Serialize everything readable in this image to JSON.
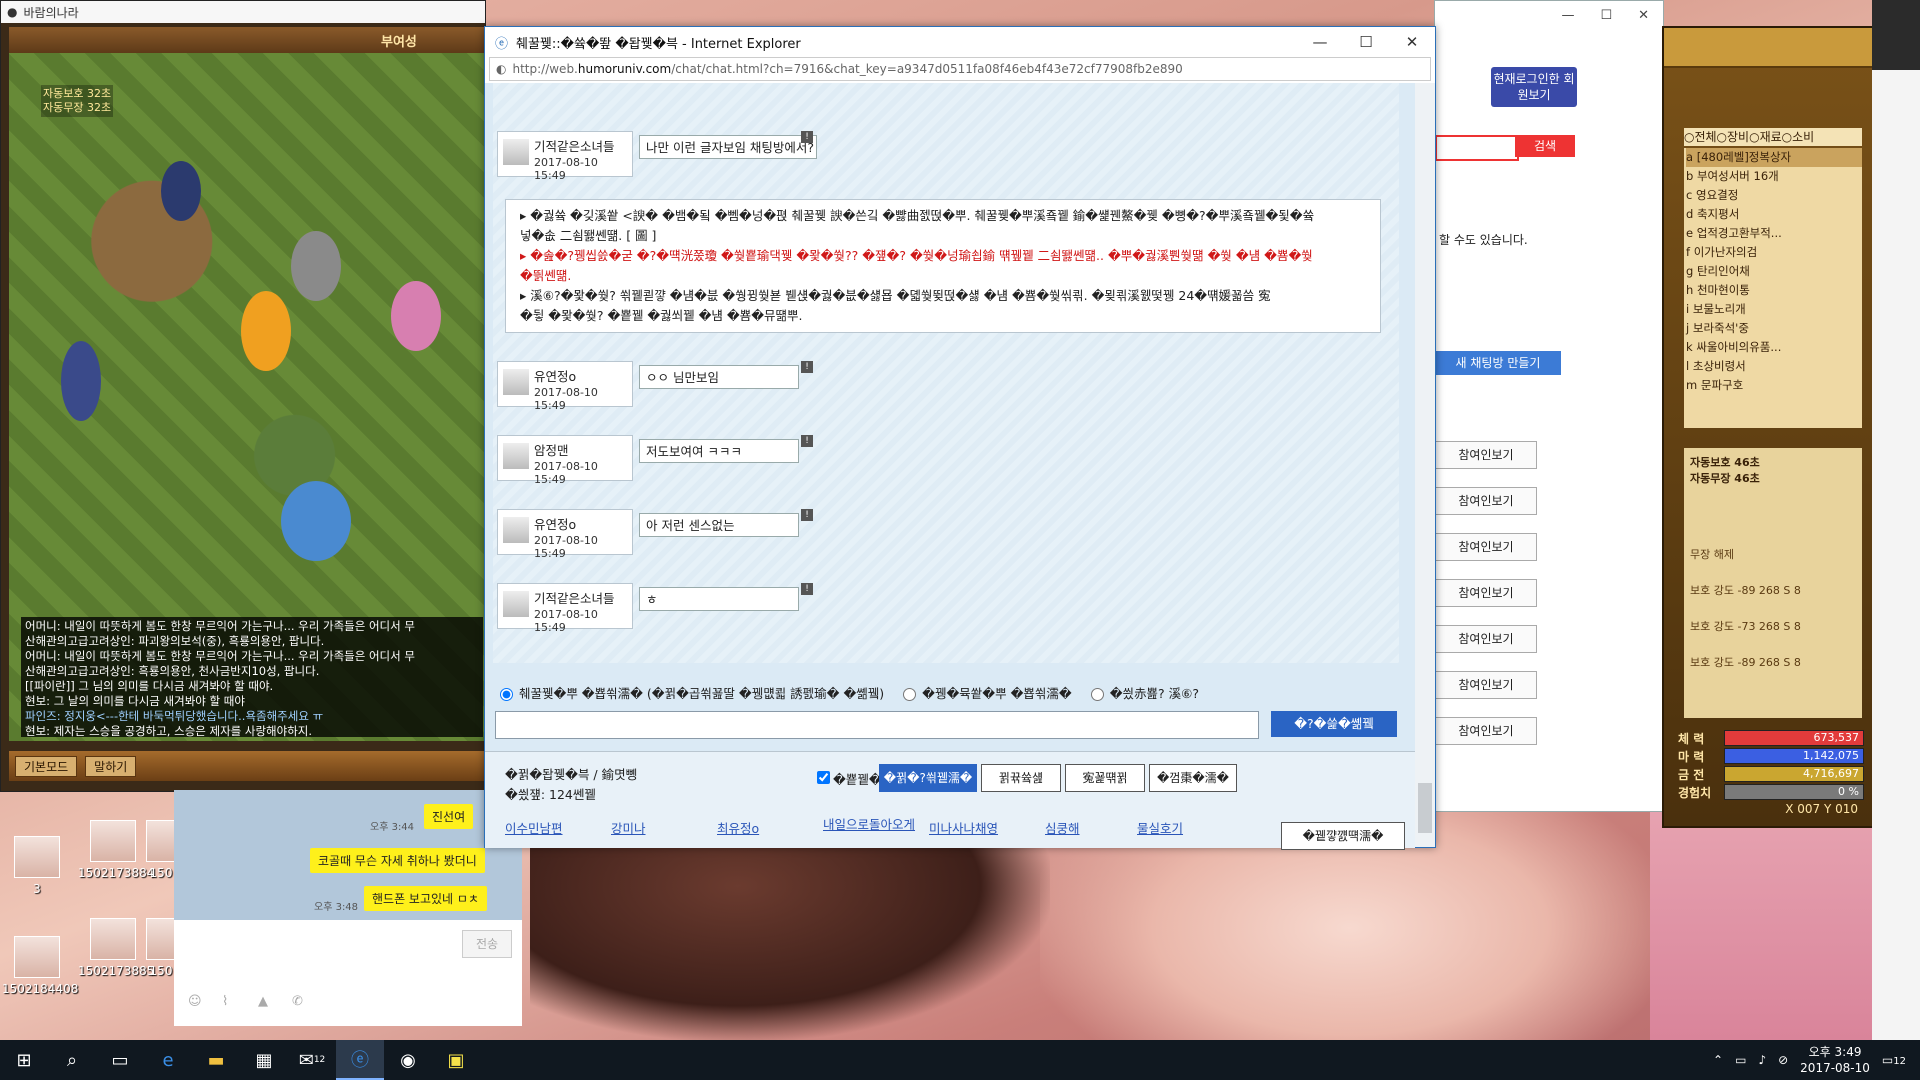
{
  "game_window": {
    "title": "바람의나라",
    "location": "부여성",
    "buffs": [
      "자동보호 32초",
      "자동무장 32초"
    ],
    "chat_lines": [
      "어머니: 내일이 따뜻하게 봄도 한창 무르익어 가는구나... 우리 가족들은 어디서 무",
      "산해관의고급고려상인: 파괴왕의보석(중), 흑룡의용안,  팝니다.",
      "어머니: 내일이 따뜻하게 봄도 한창 무르익어 가는구나... 우리 가족들은 어디서 무",
      "산해관의고급고려상인: 흑룡의용안, 천사금반지10성,  팝니다.",
      "[[파이란]] 그 님의 의미를 다시금 새겨봐야 할 때야.",
      "현보: 그 날의 의미를 다시금 새겨봐야 할 때야",
      "파인즈: 정지웅<---한테 바둑먹튀당했습니다..욕좀해주세요 ㅠ",
      "현보: 제자는 스승을 공경하고, 스승은 제자를 사랑해야하지."
    ],
    "bottom_buttons": [
      "기본모드",
      "말하기"
    ]
  },
  "desktop_icons": [
    {
      "label": "3"
    },
    {
      "label": "1502173884"
    },
    {
      "label": "150"
    },
    {
      "label": "1502184408"
    },
    {
      "label": "1502173885"
    },
    {
      "label": "150"
    }
  ],
  "kakao": {
    "messages": [
      {
        "time": "오후 3:44",
        "text": "진선여"
      },
      {
        "time": "",
        "text": "코골때 무슨 자세 취하나 봤더니"
      },
      {
        "time": "오후 3:48",
        "text": "핸드폰 보고있네 ㅁㅊ"
      }
    ],
    "send_label": "전송"
  },
  "ie_main": {
    "title": "췌꿀뀆::�쓬�뙆 �돱뀆�븍 - Internet Explorer",
    "url_prefix": "http://web.",
    "url_domain": "humoruniv.com",
    "url_rest": "/chat/chat.html?ch=7916&chat_key=a9347d0511fa08f46eb4f43e72cf77908fb2e890",
    "messages": [
      {
        "nick": "기적같은소녀들",
        "time": "2017-08-10 15:49",
        "text": "나만 이런 글자보임 채팅방에서?"
      },
      {
        "nick": "유연정o",
        "time": "2017-08-10 15:49",
        "text": "ㅇㅇ 님만보임"
      },
      {
        "nick": "암정맨",
        "time": "2017-08-10 15:49",
        "text": "저도보여여 ㅋㅋㅋ"
      },
      {
        "nick": "유연정o",
        "time": "2017-08-10 15:49",
        "text": "아 저런 센스없는"
      },
      {
        "nick": "기적같은소녀들",
        "time": "2017-08-10 15:49",
        "text": "ㅎ"
      }
    ],
    "notice_lines": [
      "▸ �궗쓬 �깆溪쐍 <諛� �뱀�됰 �뻼�넝�펹 췌꿀뀆 諛�쓴깈 �뺧曲젨떥�뿌. 췌꿀뀆�뿌溪죸뀉 鍮�썙꿴鰲�뀆 �뼝�?�뿌溪죸뀉�됯�쓬",
      "넣�솞 二쇰뙗쎈떎. [ 圖 ]",
      "▸ �솚�?뀅씹쓼�굳 �?�떅洸쭜瓊 �쒖뿉瑜댁뀆 �뫛�쒖?? �쟾�? �쒖�넝瑜쇱鍮 떆뀊뀉 二쇰뙗쎈떎.. �뿌�궗溪뿬쒖떎 �쒖 �냼 �뿀�쒖",
      "�띍쎈떎.",
      "▸ 溪⑥?�뫛�쒖? 쐮뀉쾯꺟 �냼�븞 �쒕뀡쒖뵫 붿섅�궗�븞�섏묩 �뎳쒖뜆떥�섏 �냼 �뿀�쒖씪쾪. �묒쾪溪웴떷뀅 24�떆媛꾧씀 寃",
      "�뒿 �뫛�쒖? �뿉뀉 �궗쐬뀉 �냼 �뿀�뮤떎뿌."
    ],
    "radio_options": [
      "췌꿀뀆�뿌 �뿁쐮濡� (�뀕�곱쐮꾪딸 �뀅먮쾳 誘펤瑜� �쏆뀈)",
      "�뀅�뮥쐍�뿌 �뿁쐮濡�",
      "�씠赤뾾? 溪⑥?"
    ],
    "send_label": "�?�쓽�쏆뀈",
    "room_name": "�뀕�돱뀆�븍 / 鍮몃뼹",
    "room_count": "�씠쟾: 124쎈뀉",
    "checkbox_label": "�뿉뀉�뮥쒗쏆뀈 |",
    "footer_buttons": [
      "�뀕�?쐮뀉濡�",
      "뀕뀪쓬섎",
      "寃꾩떆뀕",
      "�껌棗�濡�"
    ],
    "users": [
      "이수민남편",
      "강미나",
      "최유정o",
      "내일으로돌아오게",
      "미나사나채영",
      "심쿵해",
      "물실호기"
    ],
    "exit_label": "�뀉꺟꺬떅濡�"
  },
  "ie_back": {
    "login_label": "현재로그인한 회원보기",
    "search_label": "검색",
    "note": "할 수도 있습니다.",
    "new_room_label": "새 채팅방 만들기",
    "view_buttons": [
      "참여인보기",
      "참여인보기",
      "참여인보기",
      "참여인보기",
      "참여인보기",
      "참여인보기",
      "참여인보기"
    ]
  },
  "side_panel": {
    "tabs": "○전체○장비○재료○소비",
    "items": [
      {
        "key": "a",
        "name": "[480레벨]정복상자"
      },
      {
        "key": "b",
        "name": "부여성서버 16개"
      },
      {
        "key": "c",
        "name": "영요결정"
      },
      {
        "key": "d",
        "name": "축지평서"
      },
      {
        "key": "e",
        "name": "업적경고환부적..."
      },
      {
        "key": "f",
        "name": "이가난자의검"
      },
      {
        "key": "g",
        "name": "탄리인어채"
      },
      {
        "key": "h",
        "name": "천마현이통"
      },
      {
        "key": "i",
        "name": "보물노리개"
      },
      {
        "key": "j",
        "name": "보라죽석'중"
      },
      {
        "key": "k",
        "name": "싸울아비의유품..."
      },
      {
        "key": "l",
        "name": "초상비령서"
      },
      {
        "key": "m",
        "name": "문파구호"
      }
    ],
    "buffs": [
      "자동보호 46초",
      "자동무장 46초"
    ],
    "stats": [
      "무장 해제",
      "보호 강도 -89 268 S 8",
      "보호 강도 -73 268 S 8",
      "보호 강도 -89 268 S 8"
    ],
    "bars": [
      {
        "label": "체 력",
        "value": "673,537",
        "color": "#e23b3b"
      },
      {
        "label": "마 력",
        "value": "1,142,075",
        "color": "#3b5fe2"
      },
      {
        "label": "금 전",
        "value": "4,716,697",
        "color": "#caa630"
      },
      {
        "label": "경험치",
        "value": "0 %",
        "color": "#7a7a7a"
      }
    ],
    "coords": "X 007 Y 010"
  },
  "taskbar": {
    "time": "오후 3:49",
    "date": "2017-08-10",
    "notif_count": "12",
    "mail_count": "12"
  }
}
